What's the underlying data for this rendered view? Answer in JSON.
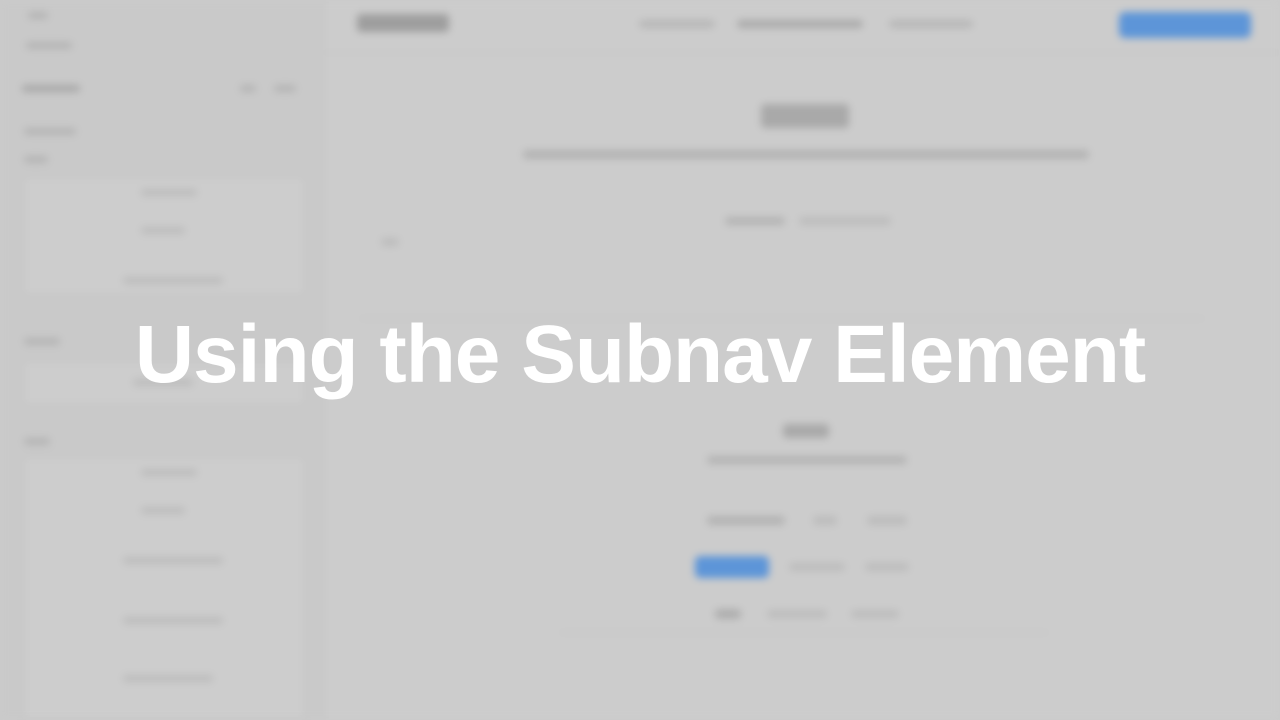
{
  "overlay": {
    "title": "Using the Subnav Element"
  },
  "colors": {
    "background": "#cbcbcb",
    "accent": "#5d95d8",
    "title_text": "#ffffff"
  }
}
